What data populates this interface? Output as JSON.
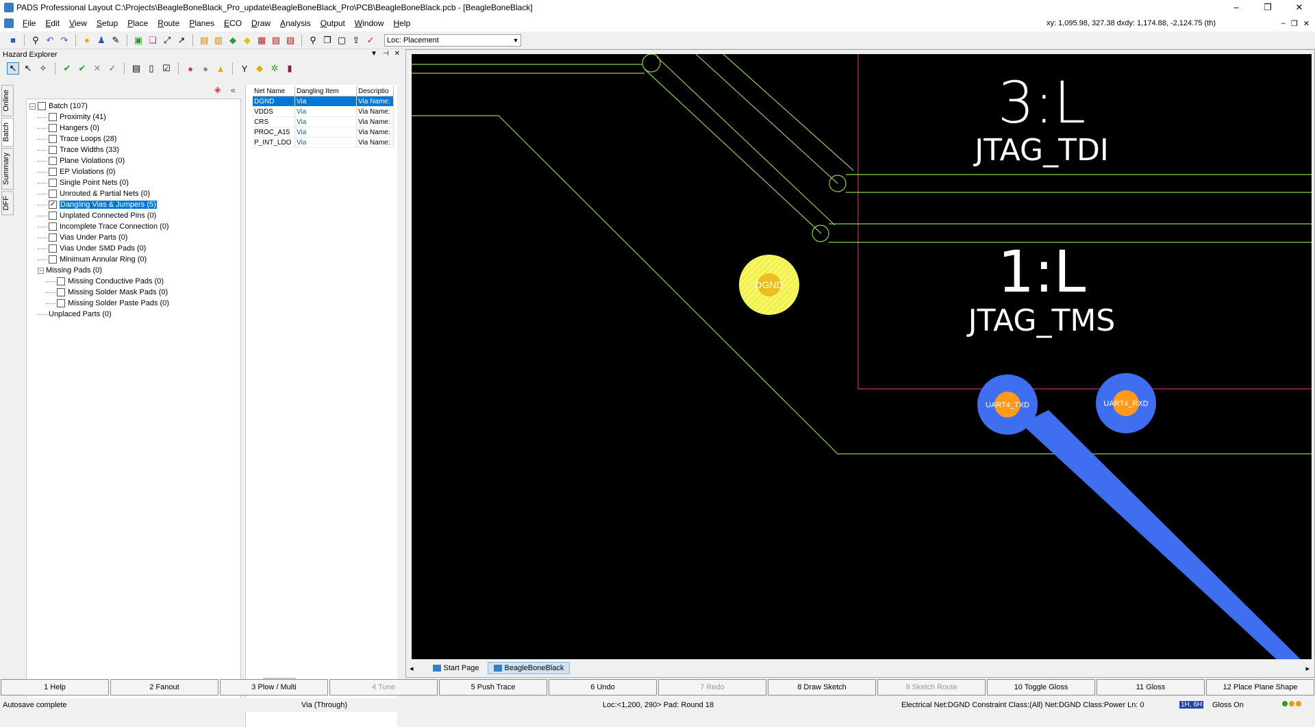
{
  "window": {
    "title": "PADS Professional Layout  C:\\Projects\\BeagleBoneBlack_Pro_update\\BeagleBoneBlack_Pro\\PCB\\BeagleBoneBlack.pcb - [BeagleBoneBlack]",
    "minimize": "–",
    "restore": "❐",
    "close": "✕"
  },
  "menu": [
    "File",
    "Edit",
    "View",
    "Setup",
    "Place",
    "Route",
    "Planes",
    "ECO",
    "Draw",
    "Analysis",
    "Output",
    "Window",
    "Help"
  ],
  "coords": "xy: 1,095.98, 327.38  dxdy: 1,174.88, -2,124.75  (th)",
  "toolbar": {
    "loc_combo": "Loc: Placement"
  },
  "hazard": {
    "title": "Hazard Explorer",
    "vtabs": [
      "Online",
      "Batch",
      "Summary",
      "DFF"
    ],
    "tree": [
      {
        "label": "Batch (107)",
        "level": 0,
        "expander": "−"
      },
      {
        "label": "Proximity (41)",
        "level": 1
      },
      {
        "label": "Hangers (0)",
        "level": 1
      },
      {
        "label": "Trace Loops (28)",
        "level": 1
      },
      {
        "label": "Trace Widths (33)",
        "level": 1
      },
      {
        "label": "Plane Violations (0)",
        "level": 1
      },
      {
        "label": "EP Violations (0)",
        "level": 1
      },
      {
        "label": "Single Point Nets (0)",
        "level": 1
      },
      {
        "label": "Unrouted & Partial Nets (0)",
        "level": 1
      },
      {
        "label": "Dangling Vias & Jumpers (5)",
        "level": 1,
        "checked": true,
        "selected": true
      },
      {
        "label": "Unplated Connected Pins (0)",
        "level": 1
      },
      {
        "label": "Incomplete Trace Connection (0)",
        "level": 1
      },
      {
        "label": "Vias Under Parts (0)",
        "level": 1
      },
      {
        "label": "Vias Under SMD Pads (0)",
        "level": 1
      },
      {
        "label": "Minimum Annular Ring (0)",
        "level": 1
      },
      {
        "label": "Missing Pads (0)",
        "level": 1,
        "expander": "−",
        "nocheck": true
      },
      {
        "label": "Missing Conductive Pads (0)",
        "level": 2
      },
      {
        "label": "Missing Solder Mask Pads (0)",
        "level": 2
      },
      {
        "label": "Missing Solder Paste Pads (0)",
        "level": 2
      },
      {
        "label": "Unplaced Parts (0)",
        "level": 1,
        "nocheck": true
      }
    ],
    "grid": {
      "headers": [
        "Net Name",
        "Dangling Item",
        "Descriptio"
      ],
      "rows": [
        [
          "DGND",
          "Via",
          "Via Name:"
        ],
        [
          "VDDS",
          "Via",
          "Via Name:"
        ],
        [
          "CRS",
          "Via",
          "Via Name:"
        ],
        [
          "PROC_A15",
          "Via",
          "Via Name:"
        ],
        [
          "P_INT_LDO",
          "Via",
          "Via Name:"
        ]
      ]
    }
  },
  "pcb": {
    "labels": {
      "l3_num": "3:L",
      "l3_net": "JTAG_TDI",
      "l1_num": "1:L",
      "l1_net": "JTAG_TMS",
      "via_net": "DGND",
      "pad1": "UART4_TXD",
      "pad2": "UART4_RXD"
    },
    "colors": {
      "background": "#000000",
      "trace": "#8fd14f",
      "outline": "#c0307a",
      "via": "#f2f24a",
      "pad_ring": "#3f6ff0",
      "pad_core": "#ff9a1a",
      "text": "#ffffff"
    }
  },
  "doc_tabs": [
    "Start Page",
    "BeagleBoneBlack"
  ],
  "fkeys": [
    {
      "label": "1 Help",
      "enabled": true
    },
    {
      "label": "2 Fanout",
      "enabled": true
    },
    {
      "label": "3 Plow / Multi",
      "enabled": true
    },
    {
      "label": "4 Tune",
      "enabled": false
    },
    {
      "label": "5 Push Trace",
      "enabled": true
    },
    {
      "label": "6 Undo",
      "enabled": true
    },
    {
      "label": "7 Redo",
      "enabled": false
    },
    {
      "label": "8 Draw Sketch",
      "enabled": true
    },
    {
      "label": "9 Sketch Route",
      "enabled": false
    },
    {
      "label": "10 Toggle Gloss",
      "enabled": true
    },
    {
      "label": "11 Gloss",
      "enabled": true
    },
    {
      "label": "12 Place Plane Shape",
      "enabled": true
    }
  ],
  "status": {
    "left": "Autosave complete",
    "item": "Via (Through)",
    "loc": "Loc:<1,200, 290> Pad: Round 18",
    "net": "Electrical Net:DGND Constraint Class:(All) Net:DGND Class:Power Ln: 0",
    "layer": "1H, 6H",
    "gloss": "Gloss On"
  }
}
